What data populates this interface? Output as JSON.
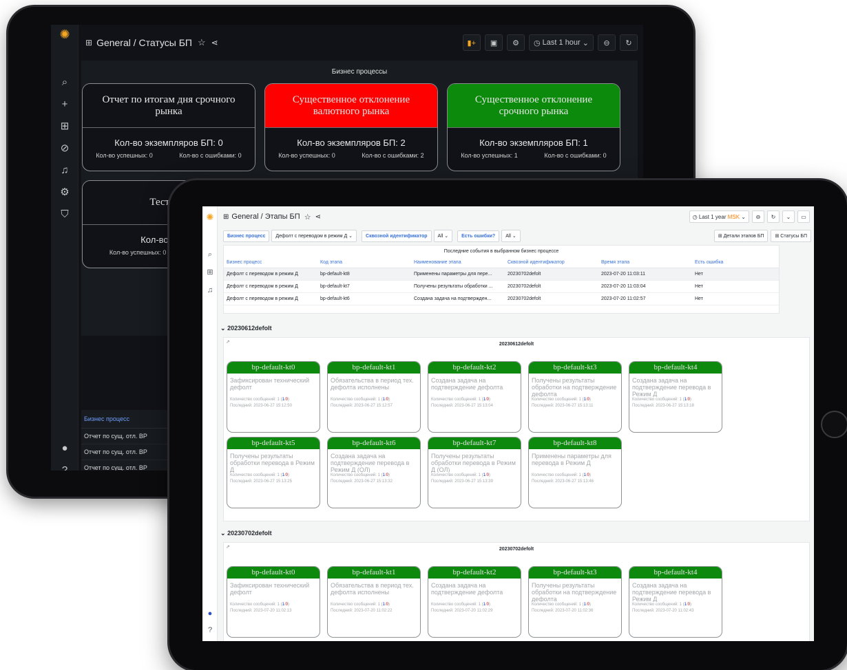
{
  "back": {
    "title": "General / Статусы БП",
    "time_range": "Last 1 hour",
    "panel_title": "Бизнес процессы",
    "cards": [
      {
        "name": "Отчет по итогам дня срочного рынка",
        "count": "Кол-во экземпляров БП: 0",
        "ok": "Кол-во успешных: 0",
        "err": "Кол-во с ошибками: 0",
        "color": "#111217"
      },
      {
        "name": "Существенное отклонение валютного рынка",
        "count": "Кол-во экземпляров БП: 2",
        "ok": "Кол-во успешных: 0",
        "err": "Кол-во с ошибками: 2",
        "color": "#ff0000"
      },
      {
        "name": "Существенное отклонение срочного рынка",
        "count": "Кол-во экземпляров БП: 1",
        "ok": "Кол-во успешных: 1",
        "err": "Кол-во с ошибками: 0",
        "color": "#0b8a0b"
      },
      {
        "name": "Тестов",
        "count": "Кол-во экзе",
        "ok": "Кол-во успешных: 0",
        "err": "",
        "color": "#111217"
      }
    ],
    "table_header": "Бизнес процесс",
    "table_rows": [
      "Отчет по сущ. отл. ВР",
      "Отчет по сущ. отл. ВР",
      "Отчет по сущ. отл. ВР"
    ]
  },
  "front": {
    "title": "General / Этапы БП",
    "time_range": "Last 1 year",
    "tz": "MSK",
    "vars": [
      {
        "label": "Бизнес процесс",
        "value": "Дефолт с переводом в режим Д"
      },
      {
        "label": "Сквозной идентификатор",
        "value": "All"
      },
      {
        "label": "Есть ошибки?",
        "value": "All"
      }
    ],
    "links": [
      "Детали этапов БП",
      "Статусы БП"
    ],
    "events": {
      "title": "Последние события в выбранном бизнес процессе",
      "columns": [
        "Бизнес процесс",
        "Код этапа",
        "Наименование этапа",
        "Сквозной идентификатор",
        "Время этапа",
        "Есть ошибка"
      ],
      "rows": [
        [
          "Дефолт с переводом в режим Д",
          "bp-default-kt8",
          "Применены параметры для пере...",
          "20230702defolt",
          "2023-07-20 11:03:11",
          "Нет"
        ],
        [
          "Дефолт с переводом в режим Д",
          "bp-default-kt7",
          "Получены результаты обработки ...",
          "20230702defolt",
          "2023-07-20 11:03:04",
          "Нет"
        ],
        [
          "Дефолт с переводом в режим Д",
          "bp-default-kt6",
          "Создана задача на подтвержден...",
          "20230702defolt",
          "2023-07-20 11:02:57",
          "Нет"
        ]
      ]
    },
    "groups": [
      {
        "row_title": "20230612defolt",
        "panel_title": "20230612defolt",
        "cards": [
          {
            "code": "bp-default-kt0",
            "name": "Зафиксирован технический дефолт",
            "cnt": "Количество сообщений: 1 (",
            "ok": "1",
            "err": "0",
            "last": "Последний: 2023-06-27 15:12:50"
          },
          {
            "code": "bp-default-kt1",
            "name": "Обязательства в период тех. дефолта исполнены",
            "cnt": "Количество сообщений: 1 (",
            "ok": "1",
            "err": "0",
            "last": "Последний: 2023-06-27 15:12:57"
          },
          {
            "code": "bp-default-kt2",
            "name": "Создана задача на подтверждение дефолта",
            "cnt": "Количество сообщений: 1 (",
            "ok": "1",
            "err": "0",
            "last": "Последний: 2023-06-27 15:13:04"
          },
          {
            "code": "bp-default-kt3",
            "name": "Получены результаты обработки на подтверждение дефолта",
            "cnt": "Количество сообщений: 1 (",
            "ok": "1",
            "err": "0",
            "last": "Последний: 2023-06-27 15:13:11"
          },
          {
            "code": "bp-default-kt4",
            "name": "Создана задача на подтверждение перевода в Режим Д",
            "cnt": "Количество сообщений: 1 (",
            "ok": "1",
            "err": "0",
            "last": "Последний: 2023-06-27 15:13:18"
          },
          {
            "code": "bp-default-kt5",
            "name": "Получены результаты обработки перевода в Режим Д",
            "cnt": "Количество сообщений: 1 (",
            "ok": "1",
            "err": "0",
            "last": "Последний: 2023-06-27 15:13:25"
          },
          {
            "code": "bp-default-kt6",
            "name": "Создана задача на подтверждение перевода в Режим Д (ОЛ)",
            "cnt": "Количество сообщений: 1 (",
            "ok": "1",
            "err": "0",
            "last": "Последний: 2023-06-27 15:13:32"
          },
          {
            "code": "bp-default-kt7",
            "name": "Получены результаты обработки перевода в Режим Д (ОЛ)",
            "cnt": "Количество сообщений: 1 (",
            "ok": "1",
            "err": "0",
            "last": "Последний: 2023-06-27 15:13:39"
          },
          {
            "code": "bp-default-kt8",
            "name": "Применены параметры для перевода в Режим Д",
            "cnt": "Количество сообщений: 1 (",
            "ok": "1",
            "err": "0",
            "last": "Последний: 2023-06-27 15:13:46"
          }
        ]
      },
      {
        "row_title": "20230702defolt",
        "panel_title": "20230702defolt",
        "cards": [
          {
            "code": "bp-default-kt0",
            "name": "Зафиксирован технический дефолт",
            "cnt": "Количество сообщений: 1 (",
            "ok": "1",
            "err": "0",
            "last": "Последний: 2023-07-20 11:02:13"
          },
          {
            "code": "bp-default-kt1",
            "name": "Обязательства в период тех. дефолта исполнены",
            "cnt": "Количество сообщений: 1 (",
            "ok": "1",
            "err": "0",
            "last": "Последний: 2023-07-20 11:02:22"
          },
          {
            "code": "bp-default-kt2",
            "name": "Создана задача на подтверждение дефолта",
            "cnt": "Количество сообщений: 1 (",
            "ok": "1",
            "err": "0",
            "last": "Последний: 2023-07-20 11:02:29"
          },
          {
            "code": "bp-default-kt3",
            "name": "Получены результаты обработки на подтверждение дефолта",
            "cnt": "Количество сообщений: 1 (",
            "ok": "1",
            "err": "0",
            "last": "Последний: 2023-07-20 11:02:36"
          },
          {
            "code": "bp-default-kt4",
            "name": "Создана задача на подтверждение перевода в Режим Д",
            "cnt": "Количество сообщений: 1 (",
            "ok": "1",
            "err": "0",
            "last": "Последний: 2023-07-20 11:02:43"
          }
        ]
      }
    ]
  }
}
